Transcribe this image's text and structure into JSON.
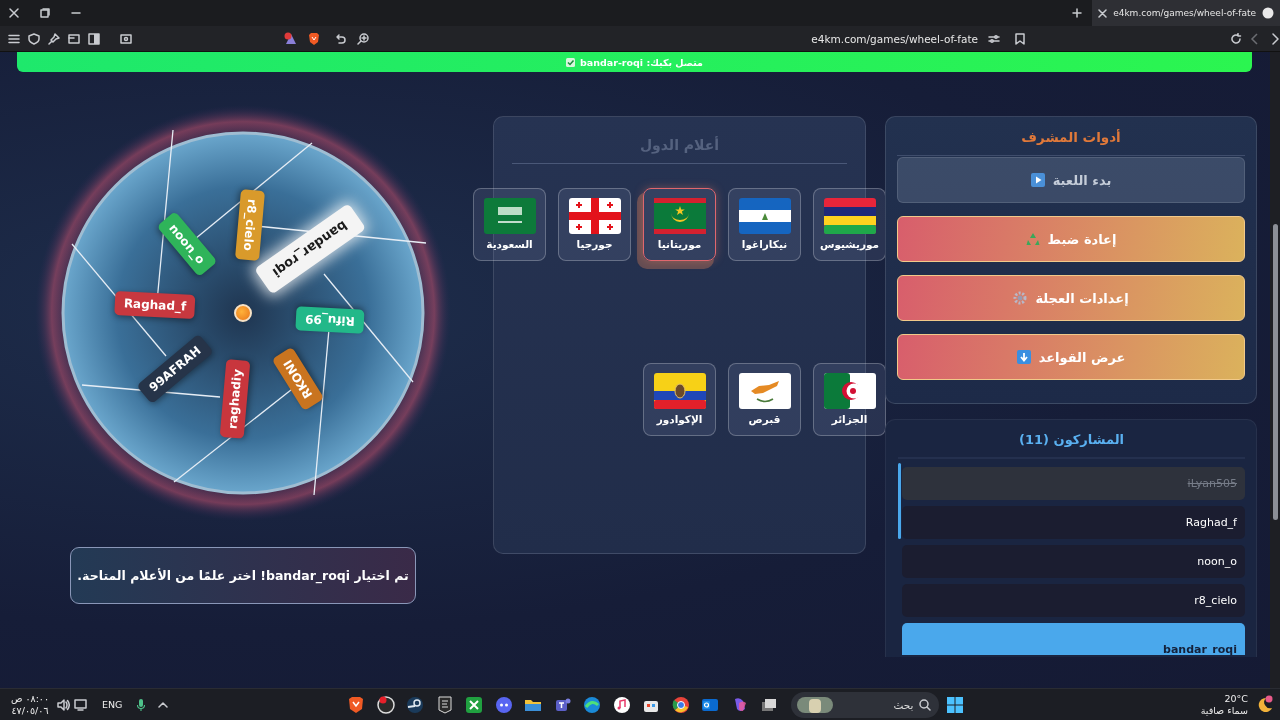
{
  "browser": {
    "tab_title": "e4km.com/games/wheel-of-fate",
    "address": "e4km.com/games/wheel-of-fate"
  },
  "banner": {
    "text": "متصل بكيك: bandar-roqi"
  },
  "wheel": {
    "segments": [
      {
        "name": "bandar_roqi",
        "color": "#f4f4f4",
        "selected": true
      },
      {
        "name": "r8_cielo",
        "color": "#d99a2b",
        "selected": false
      },
      {
        "name": "noon_o",
        "color": "#2fb45a",
        "selected": false
      },
      {
        "name": "Raghad_f",
        "color": "#c8383f",
        "selected": false
      },
      {
        "name": "99AFRAH",
        "color": "#263449",
        "selected": false
      },
      {
        "name": "raghadiy",
        "color": "#c8363d",
        "selected": false
      },
      {
        "name": "RKONI",
        "color": "#c9741f",
        "selected": false
      },
      {
        "name": "Rifu_99",
        "color": "#22b889",
        "selected": false
      }
    ]
  },
  "message": "تم اختيار bandar_roqi! اختر علمًا من الأعلام المتاحة.",
  "flags_panel": {
    "title": "أعلام الدول",
    "flags": [
      {
        "name": "موريشيوس",
        "kind": "mauritius",
        "selected": false
      },
      {
        "name": "نيكاراغوا",
        "kind": "nicaragua",
        "selected": false
      },
      {
        "name": "موريتانيا",
        "kind": "mauritania",
        "selected": true
      },
      {
        "name": "جورجيا",
        "kind": "georgia",
        "selected": false
      },
      {
        "name": "السعودية",
        "kind": "saudi",
        "selected": false
      },
      {
        "name": "الجزائر",
        "kind": "algeria",
        "selected": false
      },
      {
        "name": "قبرص",
        "kind": "cyprus",
        "selected": false
      },
      {
        "name": "الإكوادور",
        "kind": "ecuador",
        "selected": false
      }
    ]
  },
  "admin_panel": {
    "title": "أدوات المشرف",
    "buttons": [
      {
        "label": "بدء اللعبة",
        "kind": "play",
        "disabled": true
      },
      {
        "label": "إعادة ضبط",
        "kind": "recycle",
        "disabled": false
      },
      {
        "label": "إعدادات العجلة",
        "kind": "gear",
        "disabled": false
      },
      {
        "label": "عرض القواعد",
        "kind": "down",
        "disabled": false
      }
    ]
  },
  "participants": {
    "title": "المشاركون (11)",
    "items": [
      {
        "name": "iLyan505",
        "eliminated": true,
        "selected": false
      },
      {
        "name": "Raghad_f",
        "eliminated": false,
        "selected": false
      },
      {
        "name": "noon_o",
        "eliminated": false,
        "selected": false
      },
      {
        "name": "r8_cielo",
        "eliminated": false,
        "selected": false
      },
      {
        "name": "bandar_roqi",
        "eliminated": false,
        "selected": true
      }
    ]
  },
  "taskbar": {
    "time": "٠٨:٠٠ ص",
    "date": "٤٧/٠٥/٠٦",
    "language": "ENG",
    "search_placeholder": "بحث",
    "temperature": "20°C",
    "weather": "سماء صافية"
  }
}
